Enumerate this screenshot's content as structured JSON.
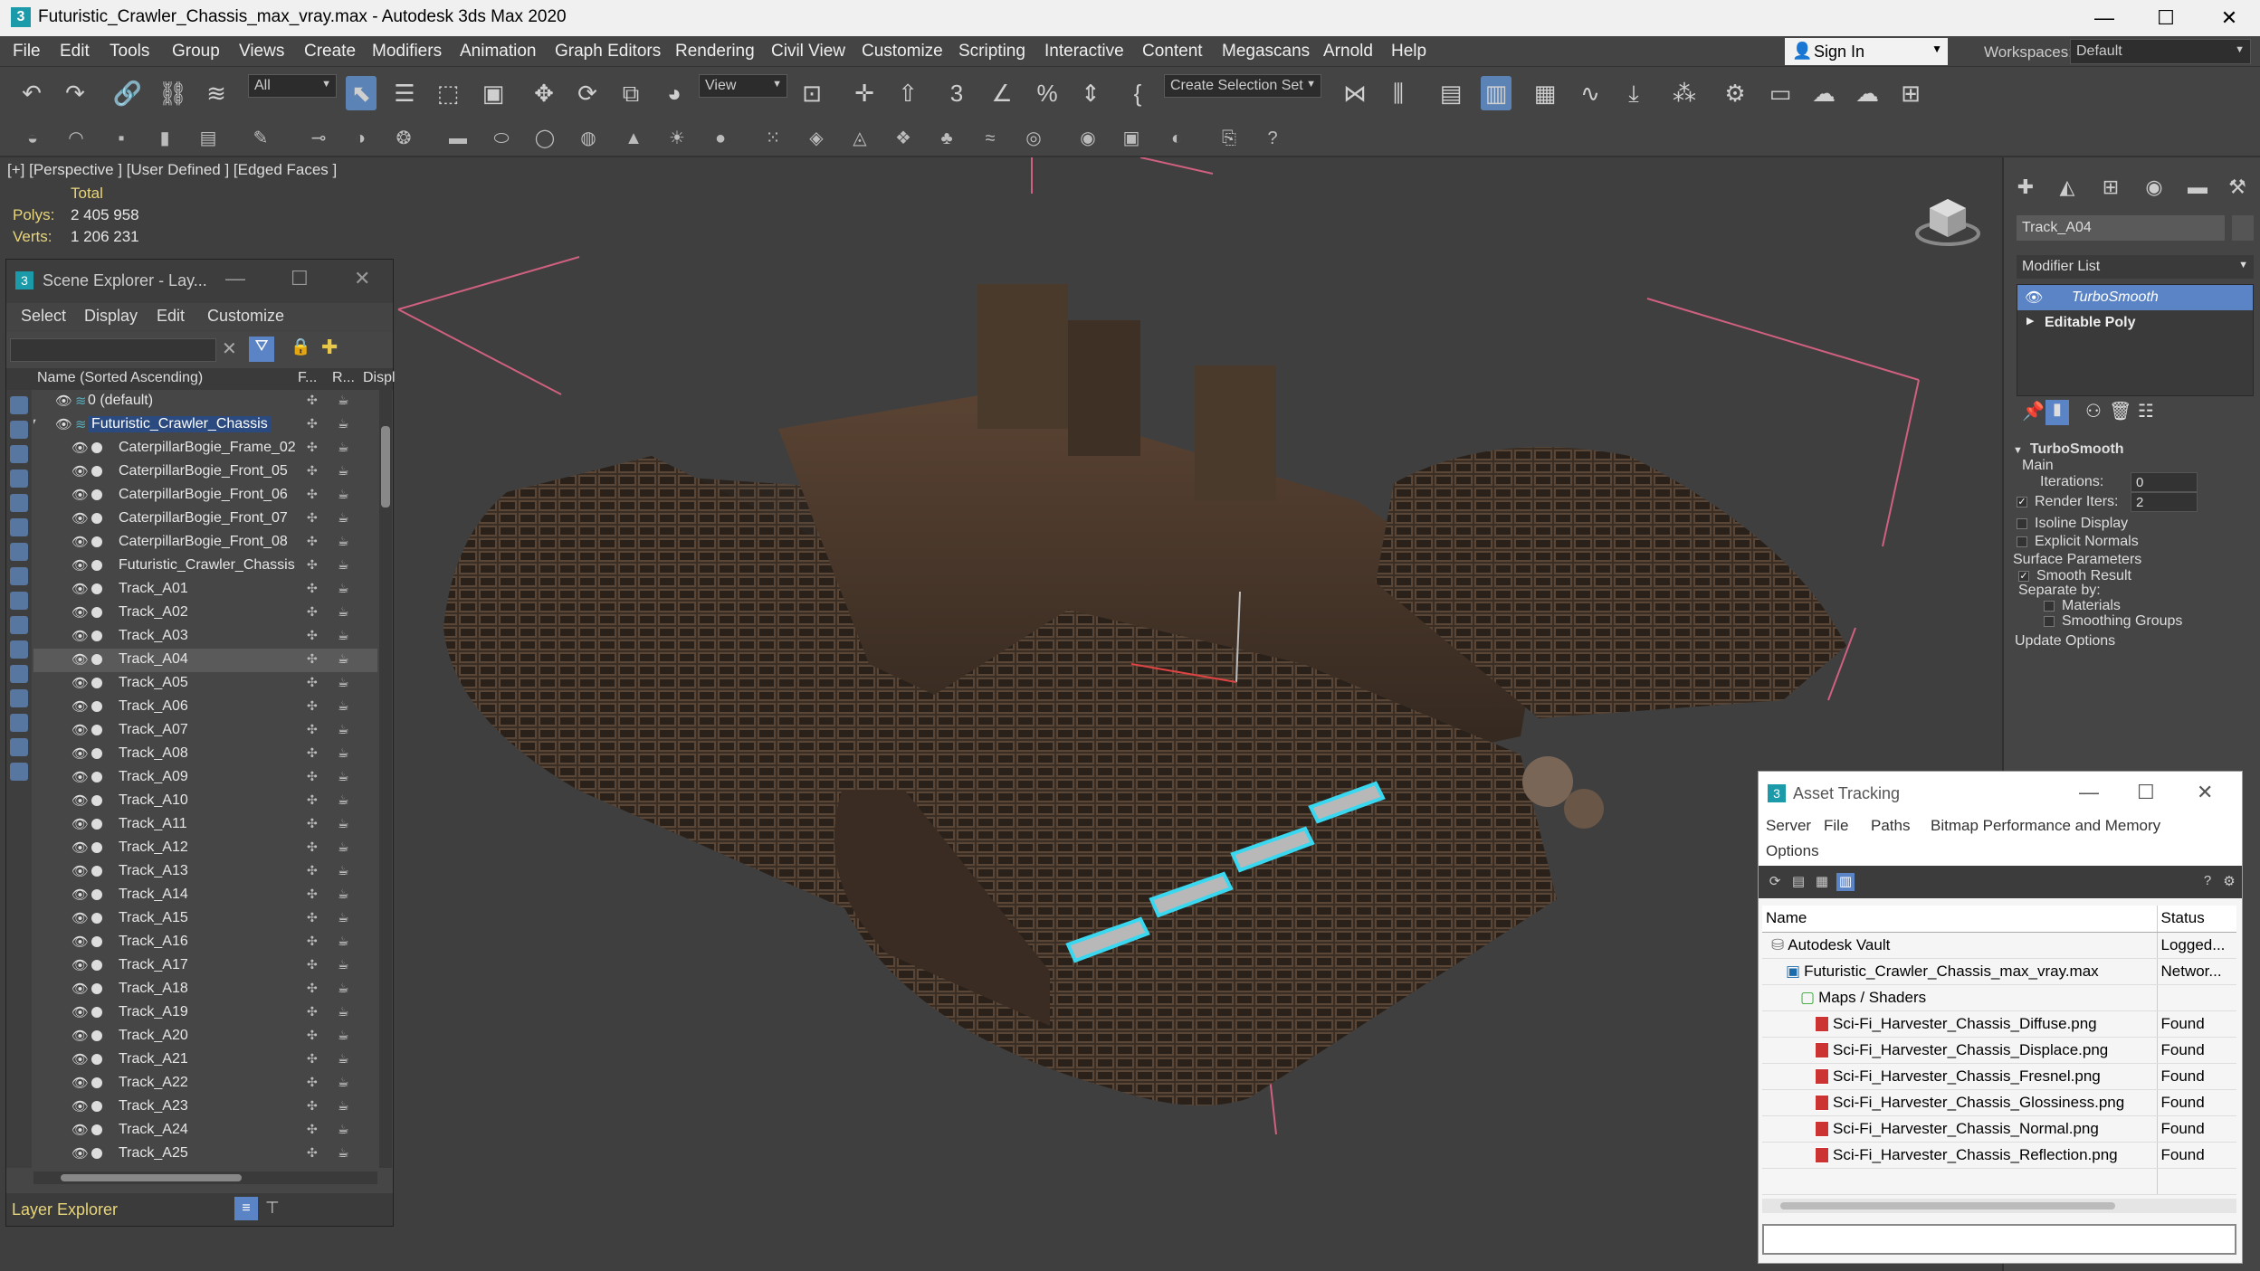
{
  "window": {
    "title": "Futuristic_Crawler_Chassis_max_vray.max - Autodesk 3ds Max 2020",
    "logo": "3"
  },
  "menu": [
    "File",
    "Edit",
    "Tools",
    "Group",
    "Views",
    "Create",
    "Modifiers",
    "Animation",
    "Graph Editors",
    "Rendering",
    "Civil View",
    "Customize",
    "Scripting",
    "Interactive",
    "Content",
    "Megascans",
    "Arnold",
    "Help"
  ],
  "signin": {
    "label": "Sign In"
  },
  "workspaces": {
    "label": "Workspaces:",
    "value": "Default"
  },
  "toolbar": {
    "filter_value": "All",
    "refcoord_value": "View",
    "selection_set_value": "Create Selection Set"
  },
  "viewport": {
    "label": "[+] [Perspective ] [User Defined ] [Edged Faces ]",
    "stats_total": "Total",
    "polys_label": "Polys:",
    "polys_value": "2 405 958",
    "verts_label": "Verts:",
    "verts_value": "1 206 231"
  },
  "scene_explorer": {
    "title": "Scene Explorer - Lay...",
    "menu": [
      "Select",
      "Display",
      "Edit",
      "Customize"
    ],
    "col_name": "Name (Sorted Ascending)",
    "col_f": "F...",
    "col_r": "R...",
    "col_disp": "Displ",
    "rows": [
      {
        "name": "0 (default)",
        "level": 0
      },
      {
        "name": "Futuristic_Crawler_Chassis",
        "level": 0
      },
      {
        "name": "CaterpillarBogie_Frame_02",
        "level": 1
      },
      {
        "name": "CaterpillarBogie_Front_05",
        "level": 1
      },
      {
        "name": "CaterpillarBogie_Front_06",
        "level": 1
      },
      {
        "name": "CaterpillarBogie_Front_07",
        "level": 1
      },
      {
        "name": "CaterpillarBogie_Front_08",
        "level": 1
      },
      {
        "name": "Futuristic_Crawler_Chassis",
        "level": 1
      },
      {
        "name": "Track_A01",
        "level": 1
      },
      {
        "name": "Track_A02",
        "level": 1
      },
      {
        "name": "Track_A03",
        "level": 1
      },
      {
        "name": "Track_A04",
        "level": 1
      },
      {
        "name": "Track_A05",
        "level": 1
      },
      {
        "name": "Track_A06",
        "level": 1
      },
      {
        "name": "Track_A07",
        "level": 1
      },
      {
        "name": "Track_A08",
        "level": 1
      },
      {
        "name": "Track_A09",
        "level": 1
      },
      {
        "name": "Track_A10",
        "level": 1
      },
      {
        "name": "Track_A11",
        "level": 1
      },
      {
        "name": "Track_A12",
        "level": 1
      },
      {
        "name": "Track_A13",
        "level": 1
      },
      {
        "name": "Track_A14",
        "level": 1
      },
      {
        "name": "Track_A15",
        "level": 1
      },
      {
        "name": "Track_A16",
        "level": 1
      },
      {
        "name": "Track_A17",
        "level": 1
      },
      {
        "name": "Track_A18",
        "level": 1
      },
      {
        "name": "Track_A19",
        "level": 1
      },
      {
        "name": "Track_A20",
        "level": 1
      },
      {
        "name": "Track_A21",
        "level": 1
      },
      {
        "name": "Track_A22",
        "level": 1
      },
      {
        "name": "Track_A23",
        "level": 1
      },
      {
        "name": "Track_A24",
        "level": 1
      },
      {
        "name": "Track_A25",
        "level": 1
      }
    ],
    "footer": "Layer Explorer"
  },
  "command_panel": {
    "object_name": "Track_A04",
    "modifier_list": "Modifier List",
    "stack": [
      "TurboSmooth",
      "Editable Poly"
    ],
    "rollout_title": "TurboSmooth",
    "main_label": "Main",
    "iterations_label": "Iterations:",
    "iterations_value": "0",
    "render_iters_label": "Render Iters:",
    "render_iters_value": "2",
    "isoline": "Isoline Display",
    "explicit": "Explicit Normals",
    "surface_params": "Surface Parameters",
    "smooth_result": "Smooth Result",
    "separate_by": "Separate by:",
    "materials": "Materials",
    "smoothing_groups": "Smoothing Groups",
    "update_options": "Update Options"
  },
  "asset_tracking": {
    "title": "Asset Tracking",
    "menu": [
      "Server",
      "File",
      "Paths",
      "Bitmap Performance and Memory",
      "Options"
    ],
    "col_name": "Name",
    "col_status": "Status",
    "rows": [
      {
        "name": "Autodesk Vault",
        "status": "Logged...",
        "indent": 1
      },
      {
        "name": "Futuristic_Crawler_Chassis_max_vray.max",
        "status": "Networ...",
        "indent": 2
      },
      {
        "name": "Maps / Shaders",
        "status": "",
        "indent": 3
      },
      {
        "name": "Sci-Fi_Harvester_Chassis_Diffuse.png",
        "status": "Found",
        "indent": 4
      },
      {
        "name": "Sci-Fi_Harvester_Chassis_Displace.png",
        "status": "Found",
        "indent": 4
      },
      {
        "name": "Sci-Fi_Harvester_Chassis_Fresnel.png",
        "status": "Found",
        "indent": 4
      },
      {
        "name": "Sci-Fi_Harvester_Chassis_Glossiness.png",
        "status": "Found",
        "indent": 4
      },
      {
        "name": "Sci-Fi_Harvester_Chassis_Normal.png",
        "status": "Found",
        "indent": 4
      },
      {
        "name": "Sci-Fi_Harvester_Chassis_Reflection.png",
        "status": "Found",
        "indent": 4
      }
    ]
  }
}
